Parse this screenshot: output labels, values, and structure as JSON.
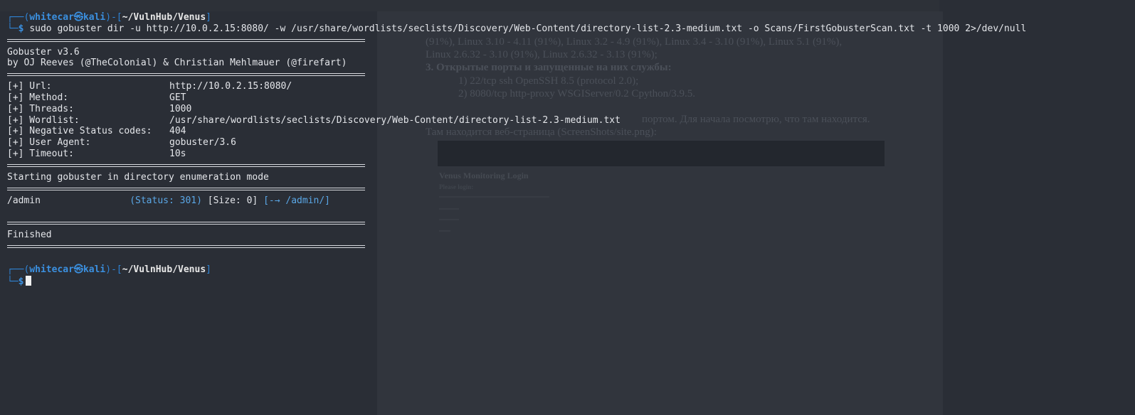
{
  "background_document": {
    "lines": [
      "(91%), Linux 3.10 - 4.11 (91%), Linux 3.2 - 4.9 (91%), Linux 3.4 - 3.10 (91%), Linux 5.1 (91%),",
      "Linux 2.6.32 - 3.10 (91%), Linux 2.6.32 - 3.13 (91%);",
      "3. Открытые порты и запущенные на них службы:",
      "1) 22/tcp ssh OpenSSH 8.5 (protocol 2.0);",
      "2) 8080/tcp http-proxy WSGIServer/0.2 Cpython/3.9.5.",
      "портом. Для начала посмотрю, что там находится.",
      "Там находится веб-страница (ScreenShots/site.png):"
    ],
    "screenshot_title": "Venus Monitoring Login",
    "screenshot_subtitle": "Please login:"
  },
  "terminal": {
    "prompt": {
      "user": "whitecar",
      "at_symbol": "㉿",
      "host": "kali",
      "path": "~/VulnHub/Venus",
      "dollar": "$"
    },
    "command": "sudo gobuster dir -u http://10.0.2.15:8080/ -w /usr/share/wordlists/seclists/Discovery/Web-Content/directory-list-2.3-medium.txt -o Scans/FirstGobusterScan.txt -t 1000 2>/dev/null",
    "banner": [
      "Gobuster v3.6",
      "by OJ Reeves (@TheColonial) & Christian Mehlmauer (@firefart)"
    ],
    "settings": [
      {
        "key": "[+] Url:",
        "value": "http://10.0.2.15:8080/"
      },
      {
        "key": "[+] Method:",
        "value": "GET"
      },
      {
        "key": "[+] Threads:",
        "value": "1000"
      },
      {
        "key": "[+] Wordlist:",
        "value": "/usr/share/wordlists/seclists/Discovery/Web-Content/directory-list-2.3-medium.txt"
      },
      {
        "key": "[+] Negative Status codes:",
        "value": "404"
      },
      {
        "key": "[+] User Agent:",
        "value": "gobuster/3.6"
      },
      {
        "key": "[+] Timeout:",
        "value": "10s"
      }
    ],
    "start_message": "Starting gobuster in directory enumeration mode",
    "result": {
      "path": "/admin",
      "status": "(Status: 301)",
      "size": "[Size: 0]",
      "redirect": "[-→ /admin/]"
    },
    "finished": "Finished"
  },
  "colors": {
    "terminal_bg": "#272b33",
    "prompt_blue": "#3b90e0",
    "status_blue": "#5aa7e6",
    "text": "#e4e6ea"
  }
}
